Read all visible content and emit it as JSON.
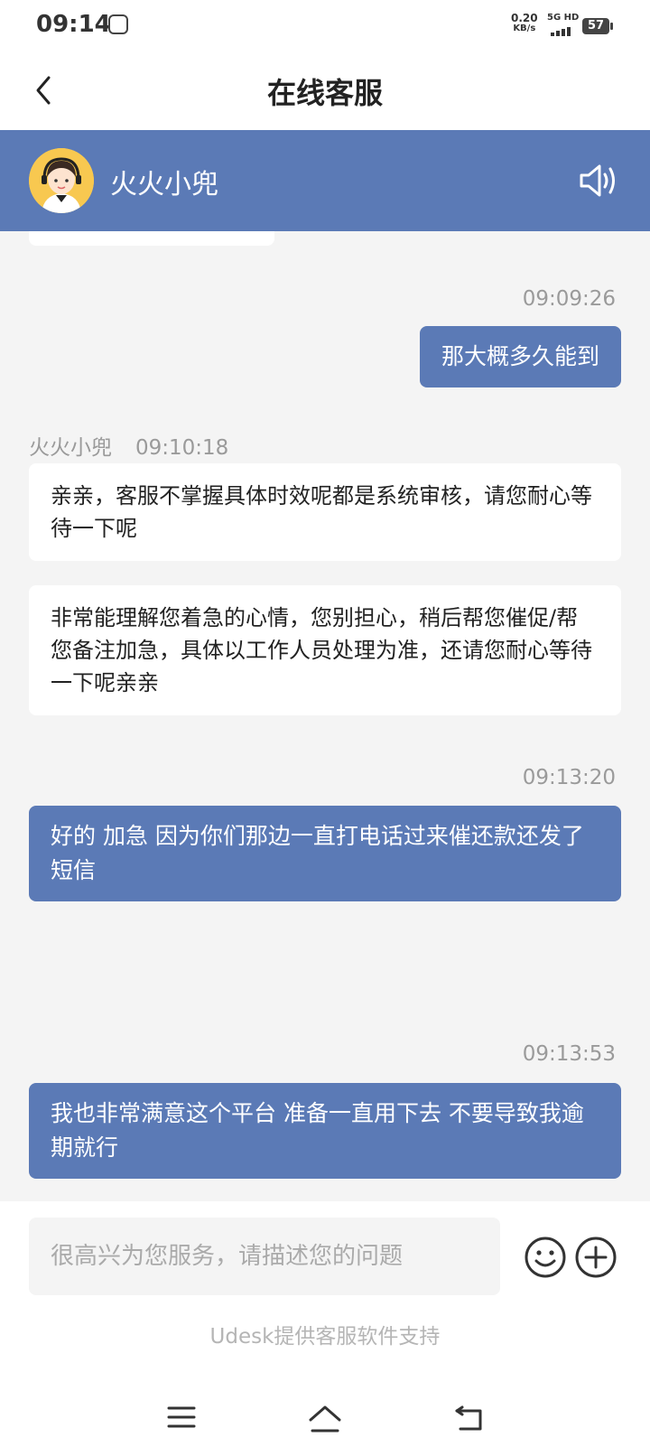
{
  "status_bar": {
    "time": "09:14",
    "net_speed_value": "0.20",
    "net_speed_unit": "KB/s",
    "network": "5G HD",
    "battery": "57"
  },
  "header": {
    "title": "在线客服"
  },
  "agent": {
    "name": "火火小兜",
    "accent_color": "#5b7ab6"
  },
  "messages": {
    "out1": {
      "time": "09:09:26",
      "text": "那大概多久能到"
    },
    "in_meta": {
      "sender": "火火小兜",
      "time": "09:10:18"
    },
    "in1": {
      "text": "亲亲，客服不掌握具体时效呢都是系统审核，请您耐心等待一下呢"
    },
    "in2": {
      "text": "非常能理解您着急的心情，您别担心，稍后帮您催促/帮您备注加急，具体以工作人员处理为准，还请您耐心等待一下呢亲亲"
    },
    "out2": {
      "time": "09:13:20",
      "text": "好的 加急 因为你们那边一直打电话过来催还款还发了短信"
    },
    "out3": {
      "time": "09:13:53",
      "text": "我也非常满意这个平台 准备一直用下去 不要导致我逾期就行"
    }
  },
  "composer": {
    "placeholder": "很高兴为您服务，请描述您的问题",
    "value": ""
  },
  "footer": {
    "powered_by": "Udesk提供客服软件支持"
  },
  "icons": {
    "back": "chevron-left-icon",
    "speaker": "speaker-icon",
    "emoji": "smiley-icon",
    "plus": "plus-circle-icon",
    "menu": "menu-icon",
    "home": "home-icon",
    "back_nav": "return-icon"
  }
}
